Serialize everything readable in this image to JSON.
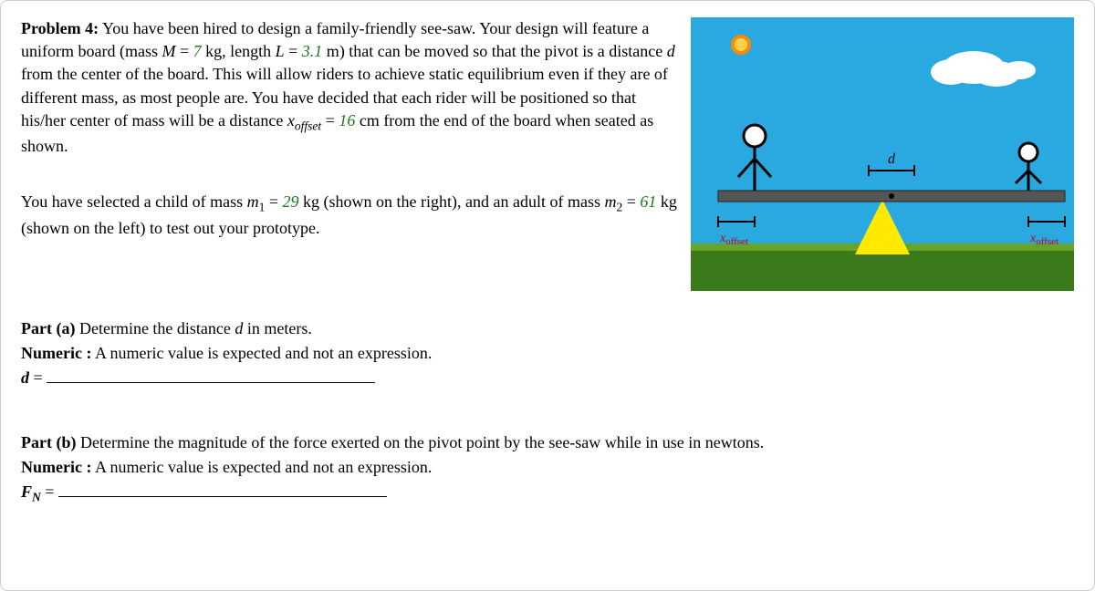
{
  "problem": {
    "label": "Problem 4:",
    "intro1a": "You have been hired to design a family-friendly see-saw. Your design will feature a uniform board (mass ",
    "var_M": "M",
    "eq1": " = ",
    "val_M": "7",
    "unit_kg": " kg",
    "intro1b": ", length ",
    "var_L": "L",
    "val_L": "3.1",
    "unit_m": " m",
    "intro1c": ") that can be moved so that the pivot is a distance ",
    "var_d": "d",
    "intro1d": " from the center of the board. This will allow riders to achieve static equilibrium even if they are of different mass, as most people are. You have decided that each rider will be positioned so that his/her center of mass will be a distance ",
    "var_xoffset": "x",
    "var_xoffset_sub": "offset",
    "val_xoffset": "16",
    "unit_cm": " cm",
    "intro1e": " from the end of the board when seated as shown.",
    "para2a": "You have selected a child of mass ",
    "var_m1": "m",
    "var_m1_sub": "1",
    "val_m1": "29",
    "para2b": " (shown on the right), and an adult of mass ",
    "var_m2": "m",
    "var_m2_sub": "2",
    "val_m2": "61",
    "para2c": " (shown on the left) to test out your prototype."
  },
  "diagram": {
    "d_label": "d",
    "xoffset_left": "x",
    "xoffset_left_sub": "offset",
    "xoffset_right": "x",
    "xoffset_right_sub": "offset"
  },
  "partA": {
    "label": "Part (a)",
    "prompt": " Determine the distance ",
    "var": "d",
    "prompt2": " in meters.",
    "hint_label": "Numeric   :",
    "hint": " A numeric value is expected and not an expression.",
    "answer_var": "d",
    "eq": " = "
  },
  "partB": {
    "label": "Part (b)",
    "prompt": " Determine the magnitude of the force exerted on the pivot point by the see-saw while in use in newtons.",
    "hint_label": "Numeric   :",
    "hint": " A numeric value is expected and not an expression.",
    "answer_var": "F",
    "answer_var_sub": "N",
    "eq": " = "
  }
}
